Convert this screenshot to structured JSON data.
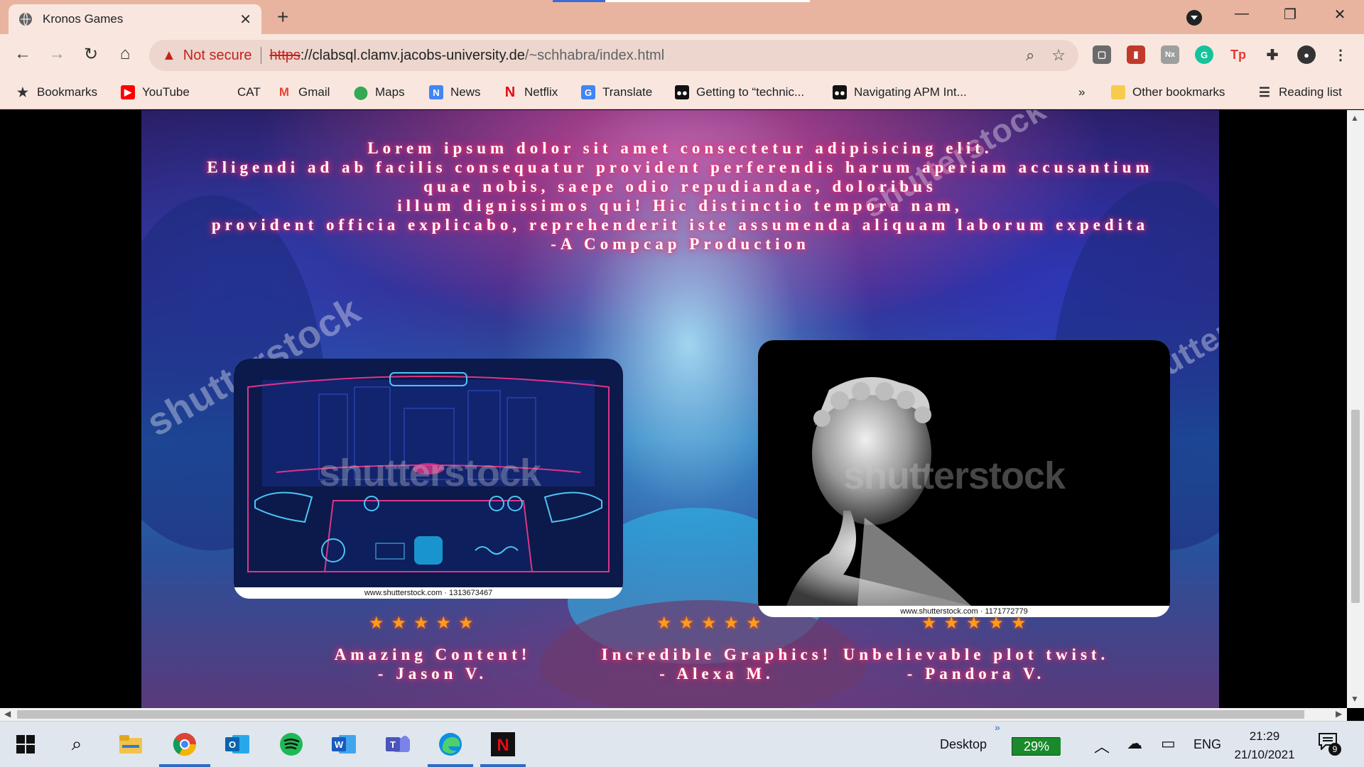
{
  "browser": {
    "tab_title": "Kronos Games",
    "security_label": "Not secure",
    "url_scheme": "https",
    "url_host": "://clabsql.clamv.jacobs-university.de",
    "url_path": "/~schhabra/index.html"
  },
  "bookmarks": {
    "items": [
      {
        "label": "Bookmarks",
        "icon": "star-icon"
      },
      {
        "label": "YouTube",
        "icon": "youtube-icon"
      },
      {
        "label": "CAT",
        "icon": "cat-icon"
      },
      {
        "label": "Gmail",
        "icon": "gmail-icon"
      },
      {
        "label": "Maps",
        "icon": "maps-icon"
      },
      {
        "label": "News",
        "icon": "news-icon"
      },
      {
        "label": "Netflix",
        "icon": "netflix-icon"
      },
      {
        "label": "Translate",
        "icon": "translate-icon"
      },
      {
        "label": "Getting to “technic...",
        "icon": "medium-icon"
      },
      {
        "label": "Navigating APM Int...",
        "icon": "medium-icon"
      }
    ],
    "overflow": "»",
    "other": "Other bookmarks",
    "reading_list": "Reading list"
  },
  "page": {
    "intro_lines": [
      "Lorem ipsum dolor sit amet consectetur adipisicing elit.",
      "Eligendi ad ab facilis consequatur provident perferendis harum aperiam accusantium",
      "quae nobis, saepe odio repudiandae, doloribus",
      "illum dignissimos qui! Hic distinctio tempora nam,",
      "provident officia explicabo, reprehenderit iste assumenda aliquam laborum expedita",
      "-A Compcap Production"
    ],
    "watermark": "shutterstock",
    "image1_credit": "www.shutterstock.com · 1313673467",
    "image2_credit": "www.shutterstock.com · 1171772779",
    "reviews": [
      {
        "stars": 5,
        "line1": "Amazing Content!",
        "line2": "- Jason V."
      },
      {
        "stars": 5,
        "line1": "Incredible Graphics!",
        "line2": "- Alexa M."
      },
      {
        "stars": 5,
        "line1": "Unbelievable plot twist.",
        "line2": "- Pandora V."
      }
    ],
    "star_glyphs": "★★★★★"
  },
  "taskbar": {
    "desktop_label": "Desktop",
    "battery": "29%",
    "battery_level": 0.29,
    "language": "ENG",
    "time": "21:29",
    "date": "21/10/2021",
    "notification_count": "9"
  },
  "colors": {
    "tabbar": "#e8b4a0",
    "toolbar": "#f9e7df",
    "neon_glow": "#ff2a6d",
    "star": "#ff9d1a",
    "insecure": "#c5221f"
  }
}
